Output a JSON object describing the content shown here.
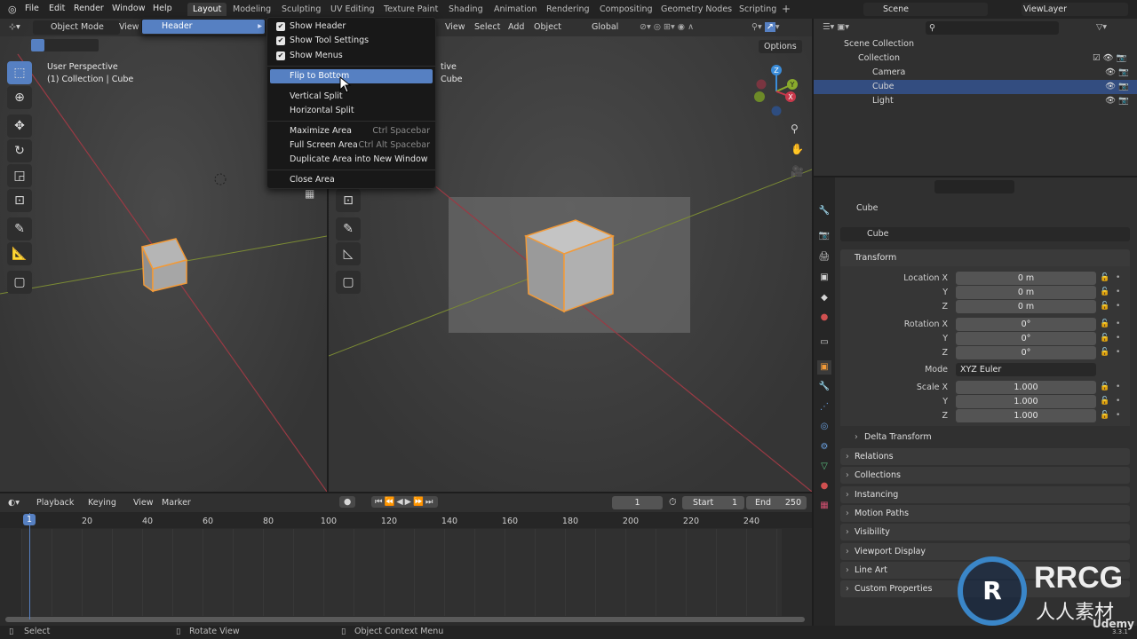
{
  "topbar": {
    "menus": [
      "File",
      "Edit",
      "Render",
      "Window",
      "Help"
    ],
    "workspaces": [
      "Layout",
      "Modeling",
      "Sculpting",
      "UV Editing",
      "Texture Paint",
      "Shading",
      "Animation",
      "Rendering",
      "Compositing",
      "Geometry Nodes",
      "Scripting"
    ],
    "active_workspace": "Layout",
    "add_tab": "+",
    "scene": "Scene",
    "view_layer": "ViewLayer"
  },
  "viewport_left": {
    "mode": "Object Mode",
    "view": "View",
    "title": "User Perspective",
    "subtitle": "(1) Collection | Cube"
  },
  "viewport_right": {
    "menus": [
      "View",
      "Select",
      "Add",
      "Object"
    ],
    "title_partial": "tive",
    "subtitle_partial": "Cube",
    "orientation": "Global",
    "options": "Options",
    "gizmo": {
      "z": "Z",
      "y": "Y",
      "x": "X"
    }
  },
  "context_menu": {
    "parent_item": "Header",
    "items": [
      {
        "label": "Show Header",
        "checked": true
      },
      {
        "label": "Show Tool Settings",
        "checked": true
      },
      {
        "label": "Show Menus",
        "checked": true
      },
      {
        "label": "Flip to Bottom",
        "highlighted": true
      },
      {
        "label": "Vertical Split"
      },
      {
        "label": "Horizontal Split"
      },
      {
        "label": "Maximize Area",
        "shortcut": "Ctrl Spacebar"
      },
      {
        "label": "Full Screen Area",
        "shortcut": "Ctrl Alt Spacebar"
      },
      {
        "label": "Duplicate Area into New Window"
      },
      {
        "label": "Close Area"
      }
    ]
  },
  "outliner": {
    "search_placeholder": "",
    "root": "Scene Collection",
    "collection": "Collection",
    "items": [
      {
        "label": "Camera",
        "selected": false
      },
      {
        "label": "Cube",
        "selected": true
      },
      {
        "label": "Light",
        "selected": false
      }
    ]
  },
  "properties": {
    "object_name": "Cube",
    "data_name": "Cube",
    "transform": "Transform",
    "location_label": "Location X",
    "rotation_label": "Rotation X",
    "scale_label": "Scale X",
    "y": "Y",
    "z": "Z",
    "location": [
      "0 m",
      "0 m",
      "0 m"
    ],
    "rotation": [
      "0°",
      "0°",
      "0°"
    ],
    "mode_label": "Mode",
    "mode": "XYZ Euler",
    "scale": [
      "1.000",
      "1.000",
      "1.000"
    ],
    "delta": "Delta Transform",
    "sections": [
      "Relations",
      "Collections",
      "Instancing",
      "Motion Paths",
      "Visibility",
      "Viewport Display",
      "Line Art",
      "Custom Properties"
    ]
  },
  "timeline": {
    "menus": [
      "Playback",
      "Keying",
      "View",
      "Marker"
    ],
    "current_frame": "1",
    "start_label": "Start",
    "start": "1",
    "end_label": "End",
    "end": "250",
    "ticks": [
      "1",
      "20",
      "40",
      "60",
      "80",
      "100",
      "120",
      "140",
      "160",
      "180",
      "200",
      "220",
      "240"
    ]
  },
  "statusbar": {
    "select": "Select",
    "rotate": "Rotate View",
    "context": "Object Context Menu",
    "version": "3.3.1"
  },
  "watermarks": {
    "udemy": "Udemy",
    "rrcg": "RRCG",
    "rrcg_cn": "人人素材"
  },
  "colors": {
    "accent": "#5680c2",
    "selection": "#f29a38",
    "x_axis": "#c9384b",
    "y_axis": "#8aaa2c",
    "z_axis": "#3a8cd9"
  }
}
